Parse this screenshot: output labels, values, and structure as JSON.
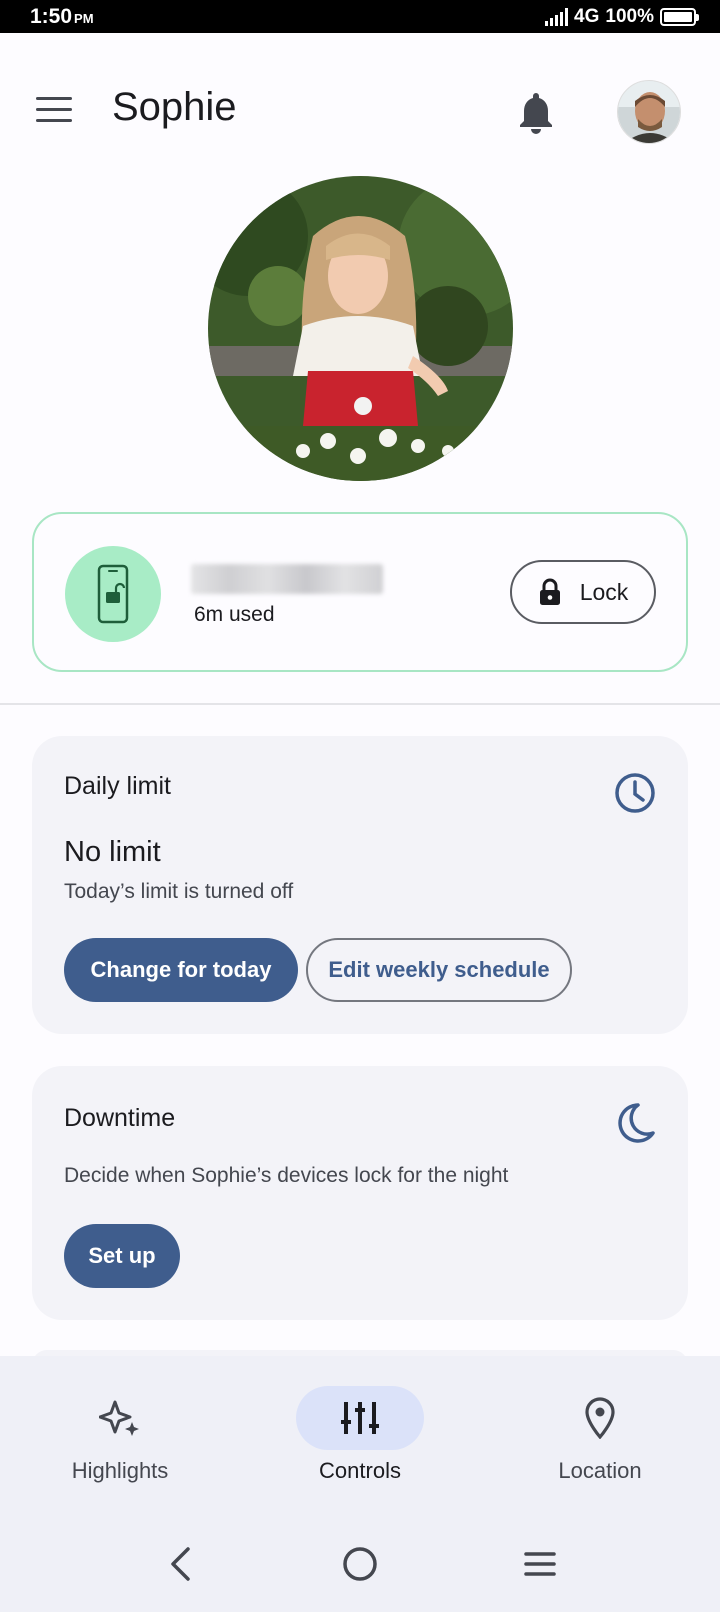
{
  "status_bar": {
    "time": "1:50",
    "ampm": "PM",
    "network": "4G",
    "battery": "100%"
  },
  "header": {
    "title": "Sophie"
  },
  "device": {
    "usage": "6m used",
    "lock_label": "Lock"
  },
  "daily_limit": {
    "title": "Daily limit",
    "status": "No limit",
    "subtitle": "Today’s limit is turned off",
    "primary_button": "Change for today",
    "secondary_button": "Edit weekly schedule"
  },
  "downtime": {
    "title": "Downtime",
    "description": "Decide when Sophie’s devices lock for the night",
    "button": "Set up"
  },
  "bottom_nav": {
    "items": [
      {
        "label": "Highlights",
        "icon": "sparkle-icon"
      },
      {
        "label": "Controls",
        "icon": "tune-sliders-icon",
        "active": true
      },
      {
        "label": "Location",
        "icon": "location-pin-icon"
      }
    ]
  },
  "colors": {
    "accent": "#3f5d8d",
    "device_ring": "#a8e6c4",
    "device_icon_bg": "#a8ecc6",
    "nav_active": "#dbe2f9"
  }
}
